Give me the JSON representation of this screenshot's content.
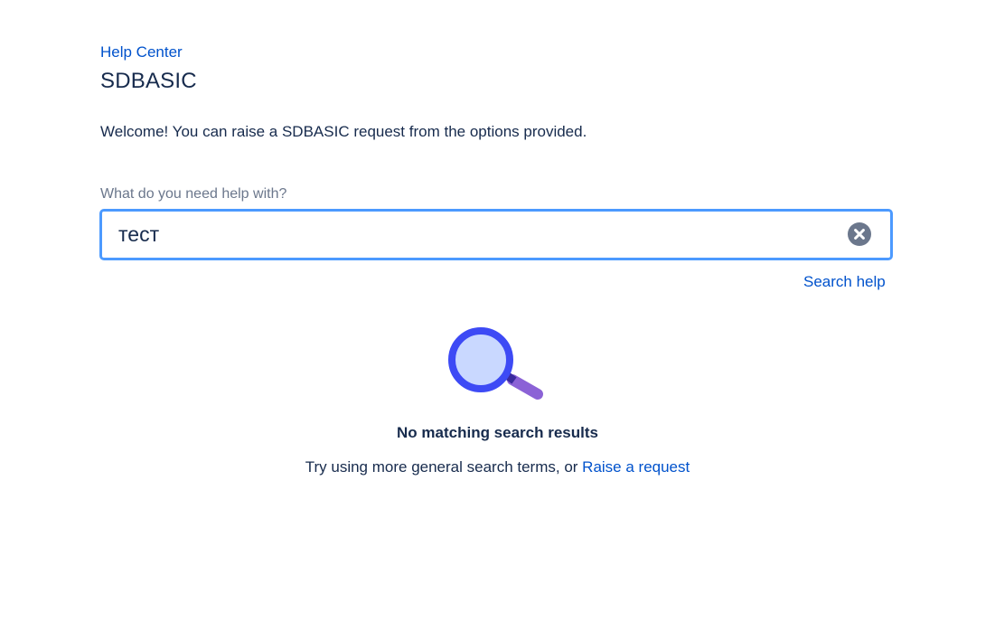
{
  "breadcrumb": {
    "label": "Help Center"
  },
  "header": {
    "title": "SDBASIC"
  },
  "welcome": {
    "text": "Welcome! You can raise a SDBASIC request from the options provided."
  },
  "search": {
    "label": "What do you need help with?",
    "value": "тест",
    "clear_icon": "clear-circle-icon",
    "help_link": "Search help"
  },
  "results": {
    "illustration_icon": "magnifying-glass-icon",
    "empty_title": "No matching search results",
    "hint_prefix": "Try using more general search terms, or ",
    "hint_link": "Raise a request"
  },
  "colors": {
    "link": "#0052cc",
    "text": "#172b4d",
    "muted": "#6b778c",
    "focus_border": "#4c9aff",
    "lens_ring": "#3d4af5",
    "lens_fill": "#c9d8ff",
    "handle": "#8b62d6"
  }
}
